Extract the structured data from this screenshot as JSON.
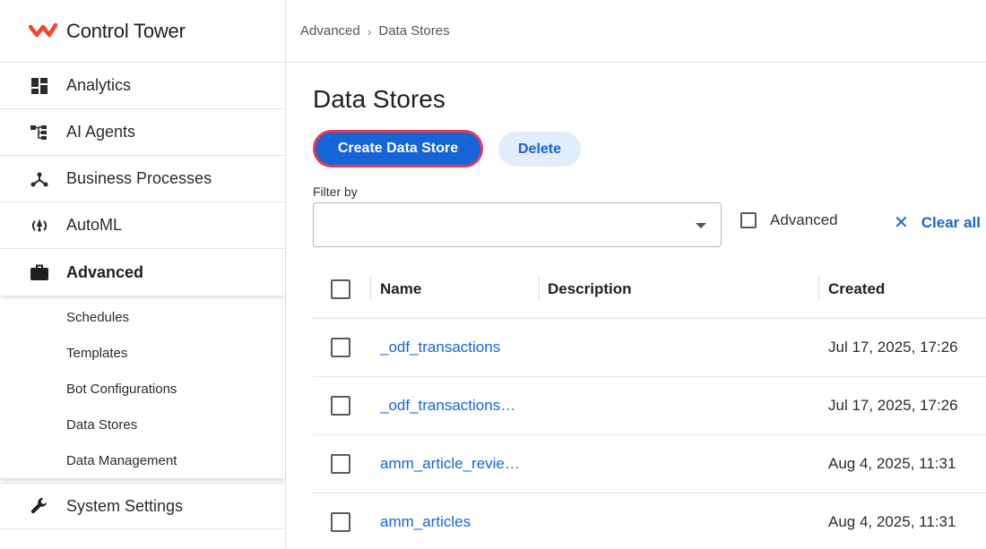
{
  "app": {
    "title": "Control Tower",
    "brand_color": "#f2442e"
  },
  "sidebar": {
    "items": [
      {
        "label": "Analytics",
        "icon": "dashboard-icon"
      },
      {
        "label": "AI Agents",
        "icon": "hierarchy-icon"
      },
      {
        "label": "Business Processes",
        "icon": "process-icon"
      },
      {
        "label": "AutoML",
        "icon": "automl-icon"
      },
      {
        "label": "Advanced",
        "icon": "briefcase-icon",
        "active": true
      }
    ],
    "subitems": [
      {
        "label": "Schedules"
      },
      {
        "label": "Templates"
      },
      {
        "label": "Bot Configurations"
      },
      {
        "label": "Data Stores"
      },
      {
        "label": "Data Management"
      }
    ],
    "system": {
      "label": "System Settings",
      "icon": "wrench-icon"
    }
  },
  "breadcrumb": {
    "parent": "Advanced",
    "current": "Data Stores"
  },
  "page": {
    "title": "Data Stores",
    "create_label": "Create Data Store",
    "delete_label": "Delete",
    "accent": "#1565d8"
  },
  "filter": {
    "label": "Filter by",
    "value": "",
    "advanced_label": "Advanced",
    "clear_label": "Clear all"
  },
  "table": {
    "columns": [
      "Name",
      "Description",
      "Created"
    ],
    "rows": [
      {
        "name": "_odf_transactions",
        "description": "",
        "created": "Jul 17, 2025, 17:26"
      },
      {
        "name": "_odf_transactions…",
        "description": "",
        "created": "Jul 17, 2025, 17:26"
      },
      {
        "name": "amm_article_revie…",
        "description": "",
        "created": "Aug 4, 2025, 11:31"
      },
      {
        "name": "amm_articles",
        "description": "",
        "created": "Aug 4, 2025, 11:31"
      }
    ]
  }
}
